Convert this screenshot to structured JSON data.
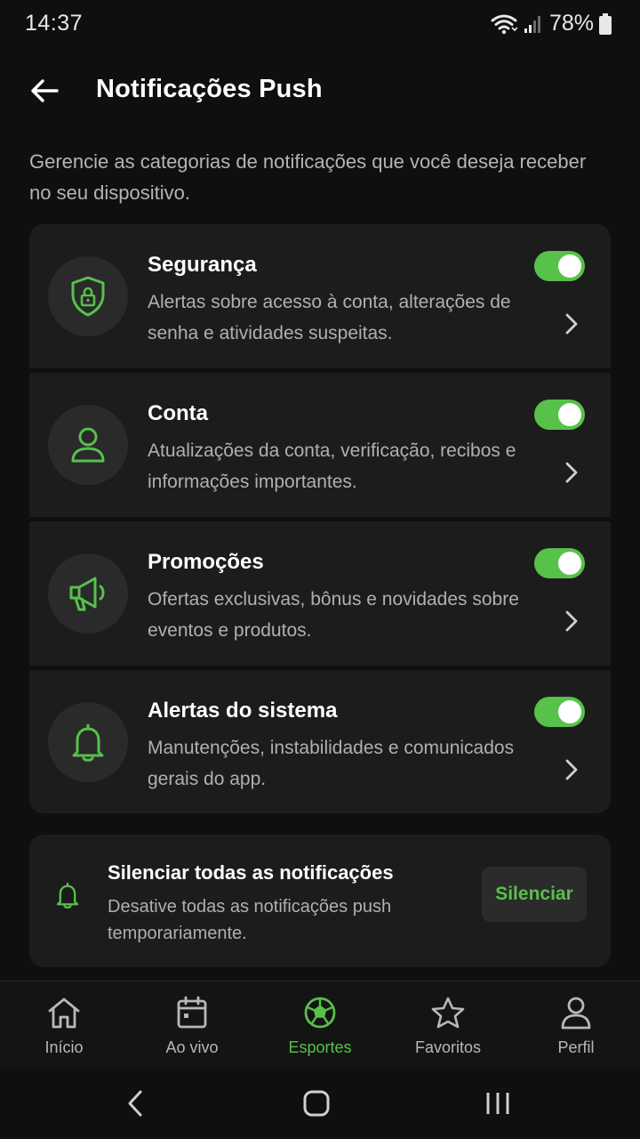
{
  "status_bar": {
    "time": "14:37",
    "battery": "78%"
  },
  "header": {
    "title": "Notificações Push"
  },
  "intro_text": "Gerencie as categorias de notificações que você deseja receber no seu dispositivo.",
  "categories": [
    {
      "title": "Segurança",
      "description": "Alertas sobre acesso à conta, alterações de senha e atividades suspeitas.",
      "icon": "shield-lock-icon",
      "enabled": true
    },
    {
      "title": "Conta",
      "description": "Atualizações da conta, verificação, recibos e informações importantes.",
      "icon": "user-icon",
      "enabled": true
    },
    {
      "title": "Promoções",
      "description": "Ofertas exclusivas, bônus e novidades sobre eventos e produtos.",
      "icon": "megaphone-icon",
      "enabled": true
    },
    {
      "title": "Alertas do sistema",
      "description": "Manutenções, instabilidades e comunicados gerais do app.",
      "icon": "bell-icon",
      "enabled": true
    }
  ],
  "mute": {
    "title": "Silenciar todas as notificações",
    "description": "Desative todas as notificações push temporariamente.",
    "button_label": "Silenciar"
  },
  "bottom_nav": [
    {
      "label": "Início",
      "icon": "home-icon",
      "active": false
    },
    {
      "label": "Ao vivo",
      "icon": "calendar-icon",
      "active": false
    },
    {
      "label": "Esportes",
      "icon": "soccer-ball-icon",
      "active": true
    },
    {
      "label": "Favoritos",
      "icon": "star-icon",
      "active": false
    },
    {
      "label": "Perfil",
      "icon": "profile-icon",
      "active": false
    }
  ],
  "colors": {
    "accent": "#57c14a",
    "background": "#0f0f0f",
    "card": "#1c1c1c",
    "icon_circle": "#2a2a2a",
    "text_secondary": "#b0b0b0"
  }
}
